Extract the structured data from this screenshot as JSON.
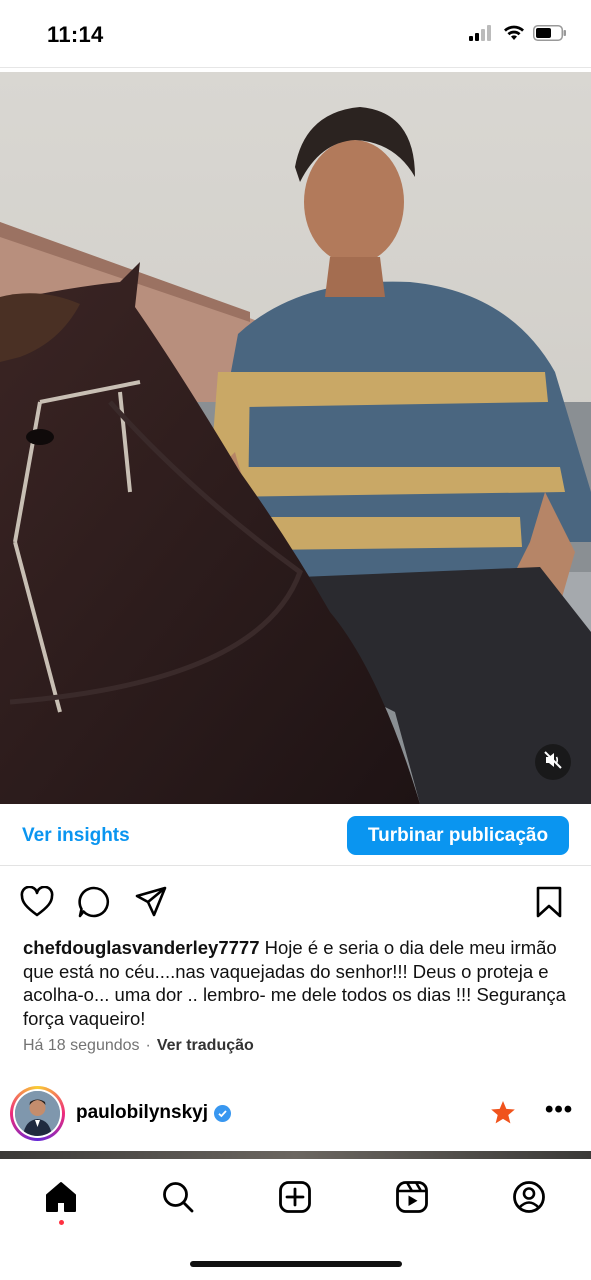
{
  "status_bar": {
    "time": "11:14"
  },
  "post": {
    "insights_label": "Ver insights",
    "boost_label": "Turbinar publicação",
    "caption_user": "chefdouglasvanderley7777",
    "caption_text": "Hoje é e seria o dia dele meu irmão que está no céu....nas vaquejadas do senhor!!! Deus o proteja e acolha-o... uma dor .. lembro- me dele todos os dias !!! Segurança força vaqueiro!",
    "timestamp": "Há 18 segundos",
    "separator": "·",
    "translate_label": "Ver tradução"
  },
  "next_post": {
    "username": "paulobilynskyj",
    "more": "•••"
  },
  "colors": {
    "accent": "#0a95f0",
    "verified": "#3897f0",
    "notification": "#ff3040",
    "star": "#f0531c"
  },
  "icons": [
    "signal-icon",
    "wifi-icon",
    "battery-icon",
    "mute-icon",
    "heart-icon",
    "comment-icon",
    "share-icon",
    "bookmark-icon",
    "verified-icon",
    "star-icon",
    "home-icon",
    "search-icon",
    "create-icon",
    "reels-icon",
    "profile-icon"
  ]
}
